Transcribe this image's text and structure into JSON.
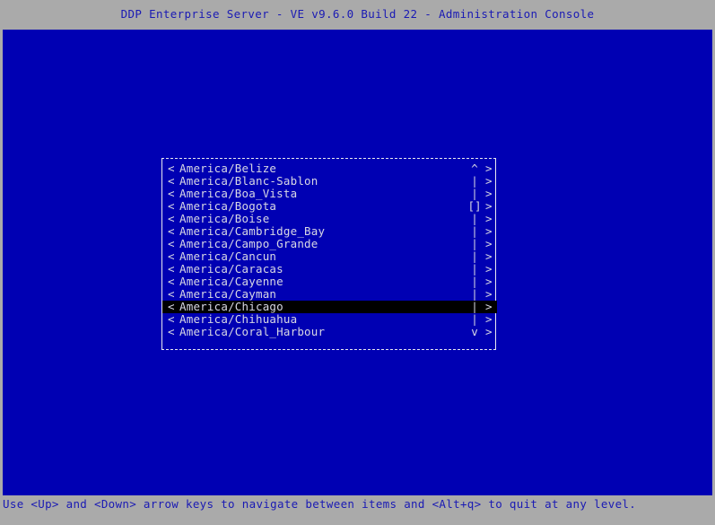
{
  "window": {
    "title": "DDP Enterprise Server - VE v9.6.0 Build 22 - Administration Console",
    "background_color": "#0000b3",
    "chrome_color": "#aaaaaa",
    "text_color": "#1a1ab4"
  },
  "statusbar": {
    "text": "Use <Up> and <Down> arrow keys to navigate between items and <Alt+q> to quit at any level."
  },
  "dialog": {
    "name": "timezone-select-list",
    "border_style": "dashed",
    "selected_index": 11,
    "scroll": {
      "up_glyph": "^",
      "down_glyph": "v",
      "track_glyph": "|",
      "thumb_glyph": "[]",
      "thumb_index": 3
    },
    "left_marker": "<",
    "right_marker": ">",
    "items": [
      {
        "label": "America/Belize",
        "scroll": "^"
      },
      {
        "label": "America/Blanc-Sablon",
        "scroll": "|"
      },
      {
        "label": "America/Boa_Vista",
        "scroll": "|"
      },
      {
        "label": "America/Bogota",
        "scroll": "[]"
      },
      {
        "label": "America/Boise",
        "scroll": "|"
      },
      {
        "label": "America/Cambridge_Bay",
        "scroll": "|"
      },
      {
        "label": "America/Campo_Grande",
        "scroll": "|"
      },
      {
        "label": "America/Cancun",
        "scroll": "|"
      },
      {
        "label": "America/Caracas",
        "scroll": "|"
      },
      {
        "label": "America/Cayenne",
        "scroll": "|"
      },
      {
        "label": "America/Cayman",
        "scroll": "|"
      },
      {
        "label": "America/Chicago",
        "scroll": "|"
      },
      {
        "label": "America/Chihuahua",
        "scroll": "|"
      },
      {
        "label": "America/Coral_Harbour",
        "scroll": "v"
      }
    ]
  }
}
